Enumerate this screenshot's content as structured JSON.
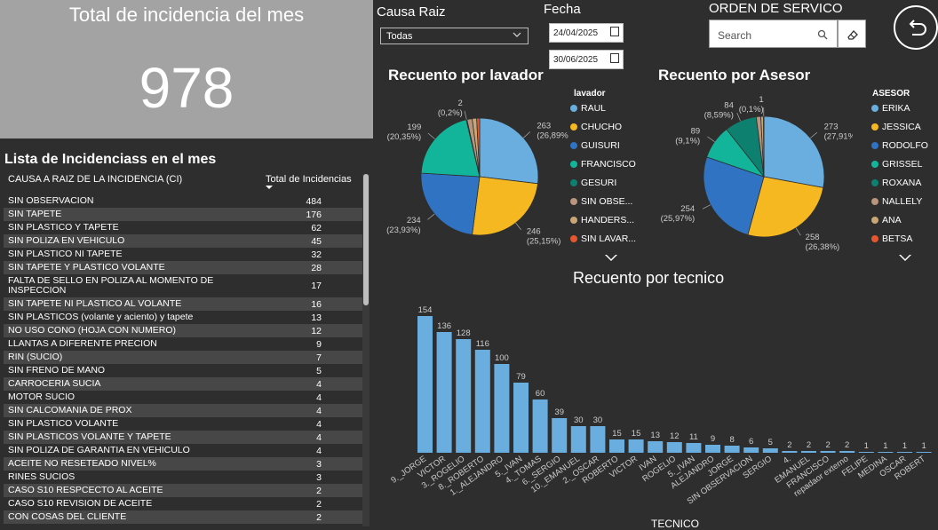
{
  "kpi": {
    "title": "Total de incidencia del mes",
    "value": "978"
  },
  "list": {
    "title": "Lista de Incidenciass en el mes",
    "col_cause": "CAUSA A RAIZ DE LA INCIDENCIA (CI)",
    "col_total": "Total de Incidencias",
    "rows": [
      {
        "cause": "SIN OBSERVACION",
        "total": "484"
      },
      {
        "cause": "SIN TAPETE",
        "total": "176"
      },
      {
        "cause": "SIN PLASTICO Y TAPETE",
        "total": "62"
      },
      {
        "cause": "SIN POLIZA EN VEHICULO",
        "total": "45"
      },
      {
        "cause": "SIN PLASTICO NI TAPETE",
        "total": "32"
      },
      {
        "cause": "SIN TAPETE Y PLASTICO VOLANTE",
        "total": "28"
      },
      {
        "cause": "FALTA DE SELLO EN POLIZA AL MOMENTO DE INSPECCION",
        "total": "17"
      },
      {
        "cause": "SIN TAPETE NI PLASTICO AL VOLANTE",
        "total": "16"
      },
      {
        "cause": "SIN PLASTICOS (volante y aciento) y tapete",
        "total": "13"
      },
      {
        "cause": "NO USO CONO (HOJA CON NUMERO)",
        "total": "12"
      },
      {
        "cause": "LLANTAS A DIFERENTE PRECION",
        "total": "9"
      },
      {
        "cause": "RIN (SUCIO)",
        "total": "7"
      },
      {
        "cause": "SIN FRENO DE MANO",
        "total": "5"
      },
      {
        "cause": "CARROCERIA SUCIA",
        "total": "4"
      },
      {
        "cause": "MOTOR SUCIO",
        "total": "4"
      },
      {
        "cause": "SIN CALCOMANIA DE PROX",
        "total": "4"
      },
      {
        "cause": "SIN PLASTICO VOLANTE",
        "total": "4"
      },
      {
        "cause": "SIN PLASTICOS VOLANTE Y TAPETE",
        "total": "4"
      },
      {
        "cause": "SIN POLIZA DE GARANTIA EN VEHICULO",
        "total": "4"
      },
      {
        "cause": "ACEITE NO RESETEADO NIVEL%",
        "total": "3"
      },
      {
        "cause": "RINES SUCIOS",
        "total": "3"
      },
      {
        "cause": "CASO S10 RESPCECTO AL ACEITE",
        "total": "2"
      },
      {
        "cause": "CASO S10 REVISION DE ACEITE",
        "total": "2"
      },
      {
        "cause": "CON COSAS DEL CLIENTE",
        "total": "2"
      }
    ]
  },
  "filters": {
    "causa_label": "Causa Raiz",
    "causa_value": "Todas",
    "fecha_label": "Fecha",
    "date_from": "24/04/2025",
    "date_to": "30/06/2025",
    "orden_label": "ORDEN DE SERVICO",
    "search_placeholder": "Search"
  },
  "icons": {
    "calendar": "calendar-icon",
    "search": "search-icon",
    "eraser": "eraser-icon",
    "back": "back-arrow-icon",
    "dropdown": "chevron-down-icon"
  },
  "chart_data": [
    {
      "type": "pie",
      "title": "Recuento por lavador",
      "legend_title": "lavador",
      "legend_position": "right",
      "categories": [
        "RAUL",
        "CHUCHO",
        "GUISURI",
        "FRANCISCO",
        "GESURI",
        "SIN OBSE...",
        "HANDERS...",
        "SIN LAVAR..."
      ],
      "values": [
        263,
        246,
        234,
        199,
        2,
        14,
        12,
        8
      ],
      "colors": [
        "#6aaee0",
        "#f6b820",
        "#2f73c2",
        "#13b59a",
        "#0d8070",
        "#b8957c",
        "#c8a774",
        "#e4572e"
      ],
      "data_labels": [
        {
          "index": 0,
          "text": "263",
          "pct": "(26,89%)"
        },
        {
          "index": 1,
          "text": "246",
          "pct": "(25,15%)"
        },
        {
          "index": 2,
          "text": "234",
          "pct": "(23,93%)"
        },
        {
          "index": 3,
          "text": "199",
          "pct": "(20,35%)"
        },
        {
          "index": 4,
          "text": "2",
          "pct": "(0,2%)"
        }
      ]
    },
    {
      "type": "pie",
      "title": "Recuento por Asesor",
      "legend_title": "ASESOR",
      "legend_position": "right",
      "categories": [
        "ERIKA",
        "JESSICA",
        "RODOLFO",
        "GRISSEL",
        "ROXANA",
        "NALLELY",
        "ANA",
        "BETSA"
      ],
      "values": [
        273,
        258,
        254,
        89,
        84,
        12,
        7,
        1
      ],
      "colors": [
        "#6aaee0",
        "#f6b820",
        "#2f73c2",
        "#13b59a",
        "#0d8070",
        "#b8957c",
        "#c8a774",
        "#e4572e"
      ],
      "data_labels": [
        {
          "index": 0,
          "text": "273",
          "pct": "(27,91%)"
        },
        {
          "index": 1,
          "text": "258",
          "pct": "(26,38%)"
        },
        {
          "index": 2,
          "text": "254",
          "pct": "(25,97%)"
        },
        {
          "index": 3,
          "text": "89",
          "pct": "(9,1%)"
        },
        {
          "index": 4,
          "text": "84",
          "pct": "(8,59%)"
        },
        {
          "index": 7,
          "text": "1",
          "pct": "(0,1%)"
        }
      ]
    },
    {
      "type": "bar",
      "title": "Recuento por tecnico",
      "xlabel": "TECNICO",
      "ylabel": "",
      "categories": [
        "9._JORGE",
        "VICTOR",
        "3._ROGELIO",
        "8._ROBERTO",
        "1._ALEJANDRO",
        "5._IVAN",
        "4._TOMAS",
        "6._SERGIO",
        "10._EMANUEL",
        "2._OSCAR",
        "ROBERTO",
        "VICTOR",
        "IVAN",
        "ROGELIO",
        "5._IVAN",
        "ALEJANDRO",
        "JORGE",
        "SIN OBSERVACION",
        "SERGIO",
        "4.",
        "EMANUEL",
        "FRANCISCO",
        "repadaor externo",
        "FELIPE",
        "MEDINA",
        "OSCAR",
        "ROBERT"
      ],
      "values": [
        154,
        136,
        128,
        116,
        100,
        79,
        60,
        39,
        30,
        30,
        15,
        15,
        13,
        12,
        11,
        9,
        8,
        6,
        5,
        2,
        2,
        2,
        2,
        1,
        1,
        1,
        1
      ],
      "color": "#6aaee0",
      "ylim": [
        0,
        160
      ]
    }
  ]
}
